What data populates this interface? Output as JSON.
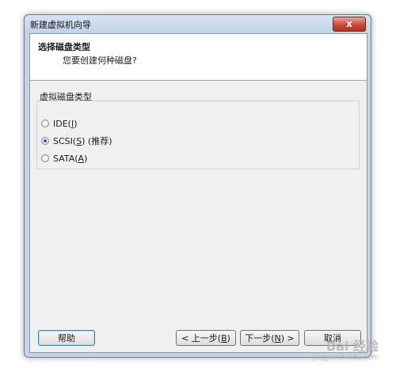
{
  "window": {
    "title": "新建虚拟机向导",
    "close_label": "x"
  },
  "header": {
    "title": "选择磁盘类型",
    "subtitle": "您要创建何种磁盘?"
  },
  "disk_group": {
    "label": "虚拟磁盘类型",
    "options": [
      {
        "text": "IDE(",
        "mnemonic": "I",
        "suffix": ")",
        "checked": false
      },
      {
        "text": "SCSI(",
        "mnemonic": "S",
        "suffix": ")  (推荐)",
        "checked": true
      },
      {
        "text": "SATA(",
        "mnemonic": "A",
        "suffix": ")",
        "checked": false
      }
    ]
  },
  "buttons": {
    "help": "帮助",
    "back": {
      "text": "< 上一步(",
      "mnemonic": "B",
      "suffix": ")"
    },
    "next": {
      "text": "下一步(",
      "mnemonic": "N",
      "suffix": ") >"
    },
    "cancel": "取消"
  },
  "watermark": {
    "main": "Bai 经验",
    "sub": "jingyan.baidu.com"
  }
}
